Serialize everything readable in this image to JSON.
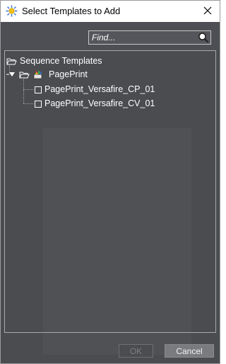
{
  "window": {
    "title": "Select Templates to Add"
  },
  "search": {
    "placeholder": "Find..."
  },
  "tree": {
    "root_label": "Sequence Templates",
    "group_label": "PagePrint",
    "items": [
      {
        "label": "PagePrint_Versafire_CP_01",
        "checked": false
      },
      {
        "label": "PagePrint_Versafire_CV_01",
        "checked": false
      }
    ]
  },
  "buttons": {
    "ok_label": "OK",
    "ok_enabled": false,
    "cancel_label": "Cancel"
  },
  "colors": {
    "panel_bg": "#4b4c50",
    "text": "#ffffff",
    "border": "#a9a9a9"
  }
}
